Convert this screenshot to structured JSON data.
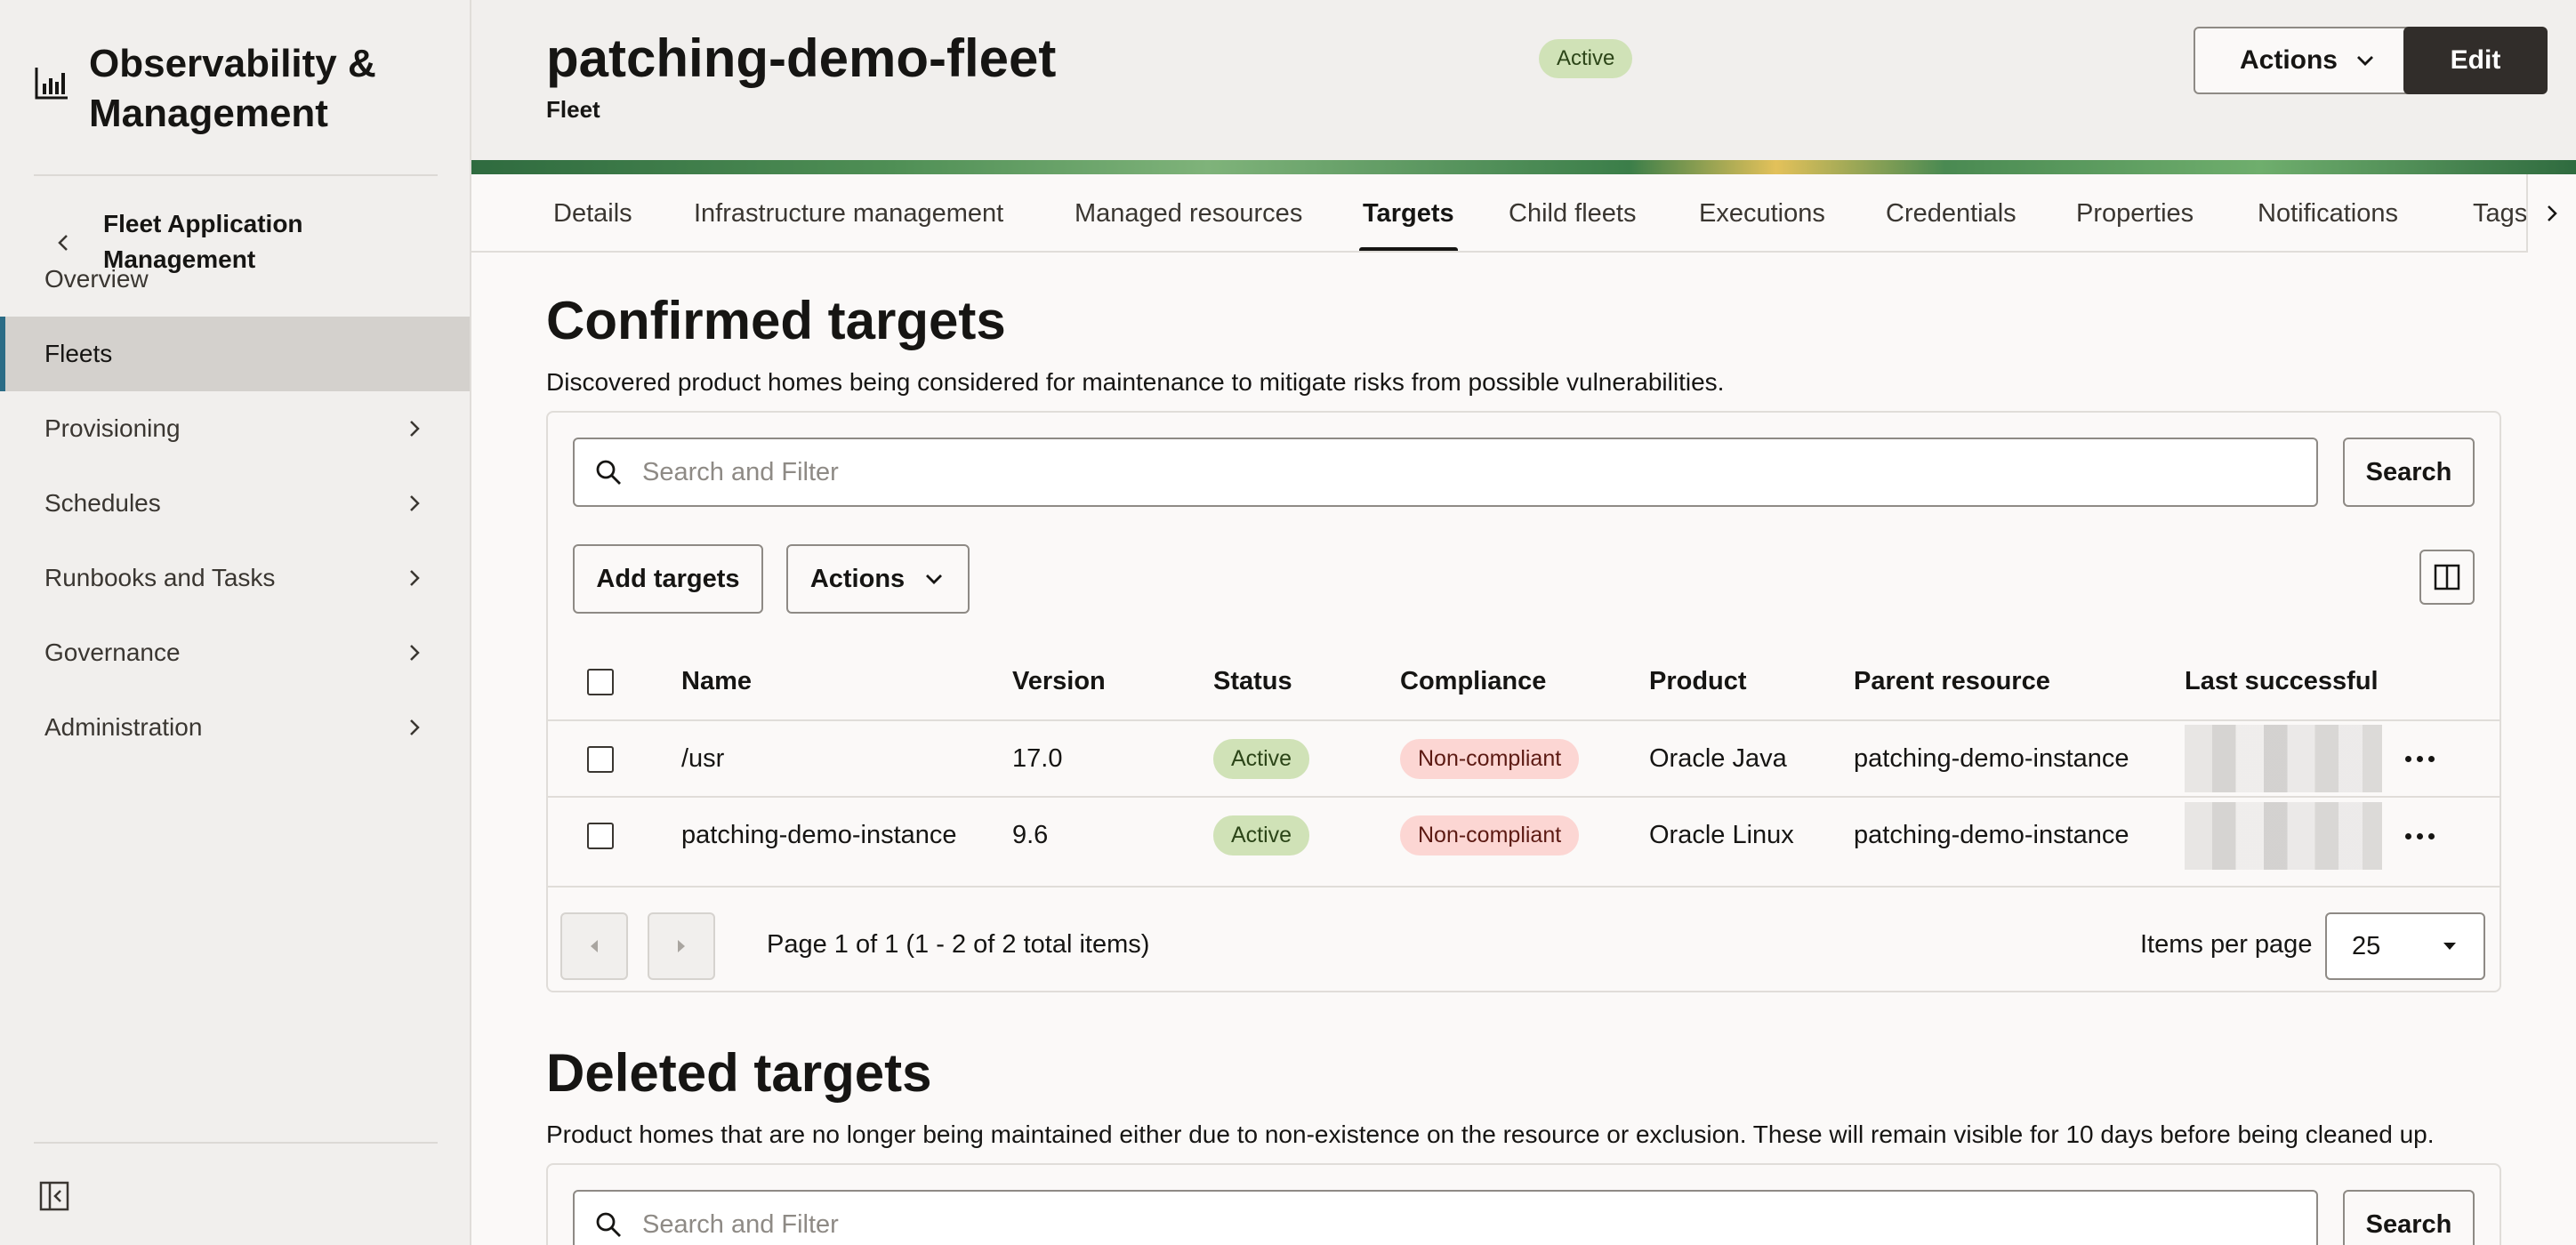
{
  "sidebar": {
    "brand_title": "Observability & Management",
    "back_label": "Fleet Application Management",
    "items": [
      {
        "label": "Overview"
      },
      {
        "label": "Fleets"
      },
      {
        "label": "Provisioning"
      },
      {
        "label": "Schedules"
      },
      {
        "label": "Runbooks and Tasks"
      },
      {
        "label": "Governance"
      },
      {
        "label": "Administration"
      }
    ],
    "active_item": "Fleets"
  },
  "header": {
    "title": "patching-demo-fleet",
    "status": "Active",
    "subtitle": "Fleet",
    "actions_label": "Actions",
    "edit_label": "Edit"
  },
  "tabs": [
    {
      "label": "Details"
    },
    {
      "label": "Infrastructure management"
    },
    {
      "label": "Managed resources"
    },
    {
      "label": "Targets"
    },
    {
      "label": "Child fleets"
    },
    {
      "label": "Executions"
    },
    {
      "label": "Credentials"
    },
    {
      "label": "Properties"
    },
    {
      "label": "Notifications"
    },
    {
      "label": "Tags"
    }
  ],
  "active_tab": "Targets",
  "confirmed": {
    "title": "Confirmed targets",
    "description": "Discovered product homes being considered for maintenance to mitigate risks from possible vulnerabilities.",
    "search_placeholder": "Search and Filter",
    "search_label": "Search",
    "add_targets_label": "Add targets",
    "actions_label": "Actions",
    "columns": [
      "Name",
      "Version",
      "Status",
      "Compliance",
      "Product",
      "Parent resource",
      "Last successful di"
    ],
    "rows": [
      {
        "name": "/usr",
        "version": "17.0",
        "status": "Active",
        "compliance": "Non-compliant",
        "product": "Oracle Java",
        "parent": "patching-demo-instance"
      },
      {
        "name": "patching-demo-instance",
        "version": "9.6",
        "status": "Active",
        "compliance": "Non-compliant",
        "product": "Oracle Linux",
        "parent": "patching-demo-instance"
      }
    ],
    "pagination_text": "Page 1 of 1 (1 - 2 of 2 total items)",
    "items_per_page_label": "Items per page",
    "items_per_page": "25"
  },
  "deleted": {
    "title": "Deleted targets",
    "description": "Product homes that are no longer being maintained either due to non-existence on the resource or exclusion. These will remain visible for 10 days before being cleaned up.",
    "search_placeholder": "Search and Filter",
    "search_label": "Search"
  },
  "colors": {
    "active_badge": "#d0e2b7",
    "noncompliant_badge": "#fcd6d3",
    "nav_accent": "#2b6c86",
    "primary_button": "#312d2a"
  }
}
